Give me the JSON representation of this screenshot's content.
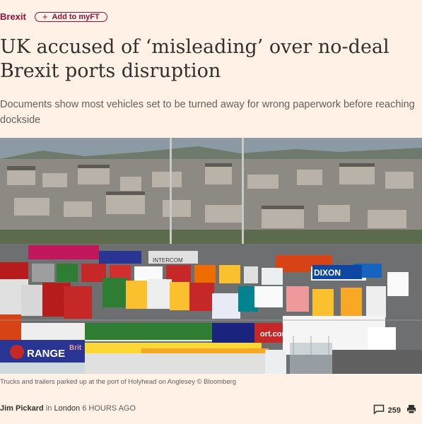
{
  "header": {
    "topic": "Brexit",
    "myft_label": "Add to myFT"
  },
  "article": {
    "headline": "UK accused of ‘misleading’ over no-deal Brexit ports disruption",
    "standfirst": "Documents show most vehicles set to be turned away for wrong paperwork before reaching dockside",
    "image_text": {
      "sign_dixon": "DIXON",
      "sign_range": "RANGE",
      "sign_brit": "Brit",
      "sign_port": "ort.com",
      "sign_intercom": "INTERCOM"
    },
    "caption": "Trucks and trailers parked up at the port of Holyhead on Anglesey © Bloomberg",
    "byline": {
      "author": "Jim Pickard",
      "connector": "in",
      "location": "London",
      "time": "6 HOURS AGO"
    },
    "comments_count": "259"
  },
  "colors": {
    "background": "#fff1e5",
    "topic": "#990f3d",
    "text": "#33302e",
    "muted": "#66605c"
  },
  "icons": [
    "plus-icon",
    "comment-icon",
    "print-icon"
  ]
}
